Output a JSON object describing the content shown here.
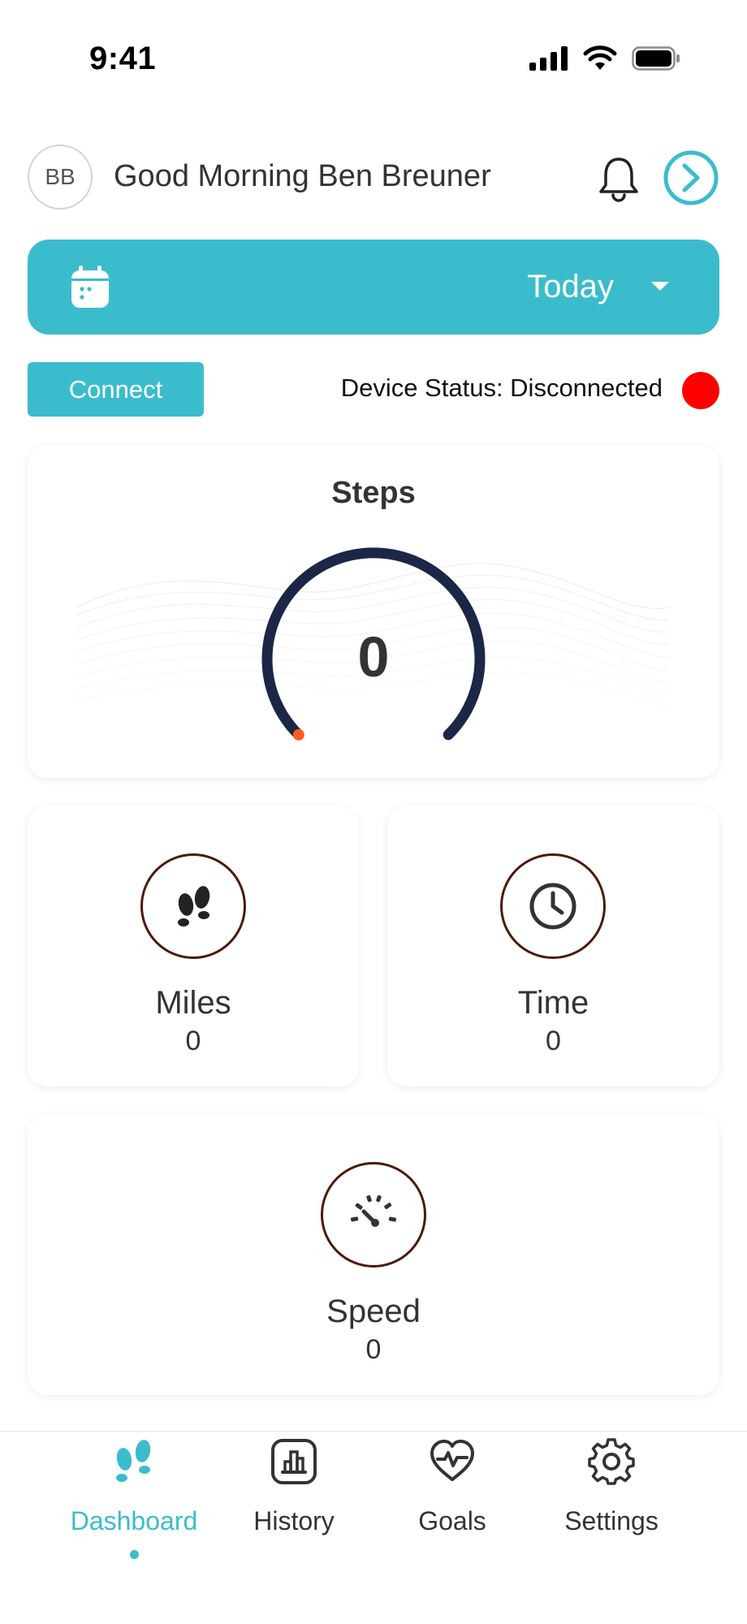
{
  "status_bar": {
    "time": "9:41"
  },
  "header": {
    "avatar_initials": "BB",
    "greeting": "Good Morning Ben Breuner",
    "icons": [
      "bell-icon",
      "arrow-right-circle-icon"
    ]
  },
  "date_selector": {
    "label": "Today",
    "icon": "calendar-icon"
  },
  "connection": {
    "button_label": "Connect",
    "status_text": "Device Status: Disconnected",
    "status_color": "#ff0000"
  },
  "steps": {
    "title": "Steps",
    "value": "0",
    "progress": 0
  },
  "metrics": {
    "miles": {
      "label": "Miles",
      "value": "0",
      "icon": "footprints-icon"
    },
    "time": {
      "label": "Time",
      "value": "0",
      "icon": "clock-icon"
    },
    "speed": {
      "label": "Speed",
      "value": "0",
      "icon": "speedometer-icon"
    }
  },
  "nav": {
    "items": [
      {
        "label": "Dashboard",
        "icon": "footprints-icon",
        "active": true
      },
      {
        "label": "History",
        "icon": "bar-chart-icon",
        "active": false
      },
      {
        "label": "Goals",
        "icon": "heart-pulse-icon",
        "active": false
      },
      {
        "label": "Settings",
        "icon": "gear-icon",
        "active": false
      }
    ]
  },
  "colors": {
    "accent": "#3bbccd",
    "gauge": "#1a2747",
    "gauge_marker": "#ff5a1f",
    "icon_ring": "#4a1a0a",
    "disconnected": "#ff0000"
  }
}
